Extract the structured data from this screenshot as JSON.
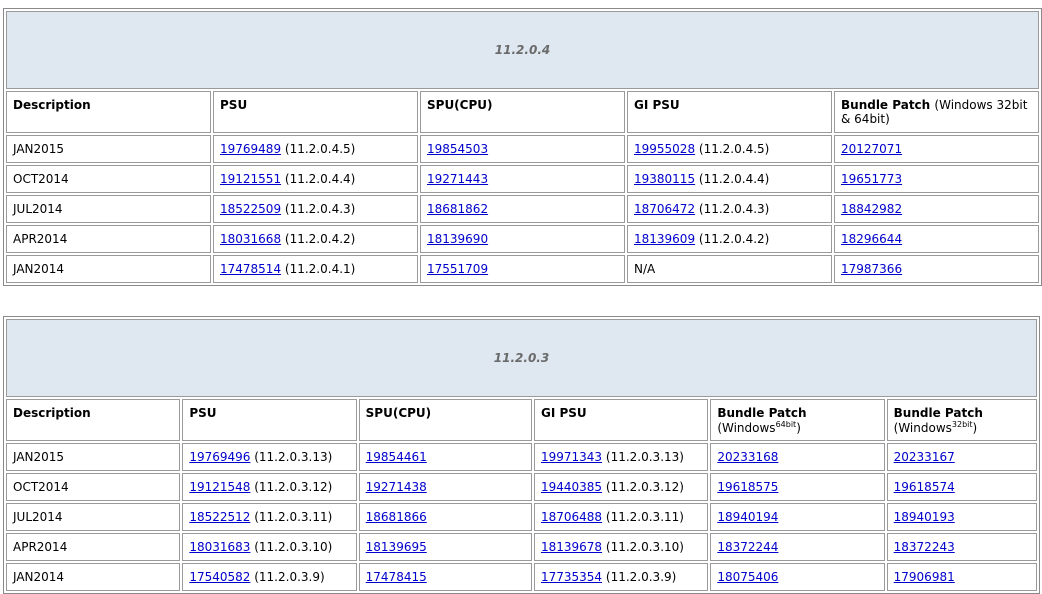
{
  "tables": [
    {
      "version": "11.2.0.4",
      "headers": {
        "description": "Description",
        "psu": "PSU",
        "spu": "SPU(CPU)",
        "gipsu": "GI PSU",
        "bundle": "Bundle Patch",
        "bundle_sub": "(Windows 32bit & 64bit)"
      },
      "rows": [
        {
          "desc": "JAN2015",
          "psu": "19769489",
          "psu_ver": "(11.2.0.4.5)",
          "spu": "19854503",
          "gi": "19955028",
          "gi_ver": "(11.2.0.4.5)",
          "bundle": "20127071"
        },
        {
          "desc": "OCT2014",
          "psu": "19121551",
          "psu_ver": "(11.2.0.4.4)",
          "spu": "19271443",
          "gi": "19380115",
          "gi_ver": "(11.2.0.4.4)",
          "bundle": "19651773"
        },
        {
          "desc": "JUL2014",
          "psu": "18522509",
          "psu_ver": "(11.2.0.4.3)",
          "spu": "18681862",
          "gi": "18706472",
          "gi_ver": "(11.2.0.4.3)",
          "bundle": "18842982"
        },
        {
          "desc": "APR2014",
          "psu": "18031668",
          "psu_ver": "(11.2.0.4.2)",
          "spu": "18139690",
          "gi": "18139609",
          "gi_ver": "(11.2.0.4.2)",
          "bundle": "18296644"
        },
        {
          "desc": "JAN2014",
          "psu": "17478514",
          "psu_ver": "(11.2.0.4.1)",
          "spu": "17551709",
          "gi_na": "N/A",
          "bundle": "17987366"
        }
      ]
    },
    {
      "version": "11.2.0.3",
      "headers": {
        "description": "Description",
        "psu": "PSU",
        "spu": "SPU(CPU)",
        "gipsu": "GI PSU",
        "bundle64": "Bundle Patch",
        "bundle64_pre": "(Windows",
        "bundle64_sup": "64bit",
        "bundle64_post": ")",
        "bundle32": "Bundle Patch",
        "bundle32_pre": "(Windows",
        "bundle32_sup": "32bit",
        "bundle32_post": ")"
      },
      "rows": [
        {
          "desc": "JAN2015",
          "psu": "19769496",
          "psu_ver": "(11.2.0.3.13)",
          "spu": "19854461",
          "gi": "19971343",
          "gi_ver": "(11.2.0.3.13)",
          "b64": "20233168",
          "b32": "20233167"
        },
        {
          "desc": "OCT2014",
          "psu": "19121548",
          "psu_ver": "(11.2.0.3.12)",
          "spu": "19271438",
          "gi": "19440385",
          "gi_ver": "(11.2.0.3.12)",
          "b64": "19618575",
          "b32": "19618574"
        },
        {
          "desc": "JUL2014",
          "psu": "18522512",
          "psu_ver": "(11.2.0.3.11)",
          "spu": "18681866",
          "gi": "18706488",
          "gi_ver": "(11.2.0.3.11)",
          "b64": "18940194",
          "b32": "18940193"
        },
        {
          "desc": "APR2014",
          "psu": "18031683",
          "psu_ver": "(11.2.0.3.10)",
          "spu": "18139695",
          "gi": "18139678",
          "gi_ver": "(11.2.0.3.10)",
          "b64": "18372244",
          "b32": "18372243"
        },
        {
          "desc": "JAN2014",
          "psu": "17540582",
          "psu_ver": "(11.2.0.3.9)",
          "spu": "17478415",
          "gi": "17735354",
          "gi_ver": "(11.2.0.3.9)",
          "b64": "18075406",
          "b32": "17906981"
        }
      ]
    }
  ]
}
